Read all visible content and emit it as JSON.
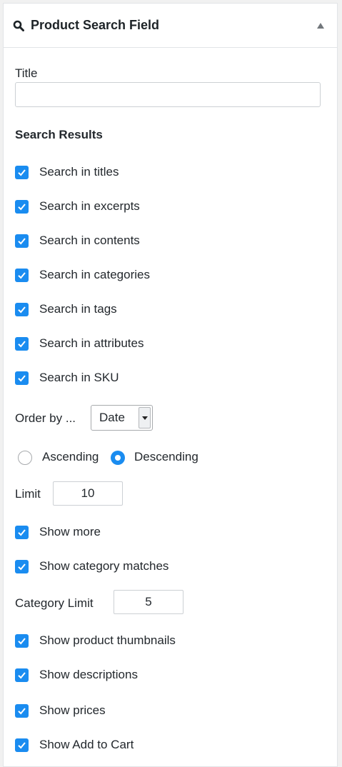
{
  "header": {
    "title": "Product Search Field",
    "icon": "search-icon",
    "toggle_icon": "collapse-arrow-icon"
  },
  "title_field": {
    "label": "Title",
    "value": ""
  },
  "search_results": {
    "heading": "Search Results",
    "checks": [
      "Search in titles",
      "Search in excerpts",
      "Search in contents",
      "Search in categories",
      "Search in tags",
      "Search in attributes",
      "Search in SKU"
    ]
  },
  "order": {
    "label": "Order by ...",
    "value": "Date"
  },
  "sort": {
    "ascending": "Ascending",
    "descending": "Descending",
    "selected": "Descending"
  },
  "limit": {
    "label": "Limit",
    "value": "10"
  },
  "more": {
    "show_more": "Show more",
    "show_category_matches": "Show category matches"
  },
  "category_limit": {
    "label": "Category Limit",
    "value": "5"
  },
  "display": {
    "thumbnails": "Show product thumbnails",
    "descriptions": "Show descriptions",
    "prices": "Show prices",
    "add_to_cart": "Show Add to Cart"
  },
  "colors": {
    "accent": "#1a8cf0",
    "border": "#e2e4e7",
    "text": "#23282d"
  }
}
